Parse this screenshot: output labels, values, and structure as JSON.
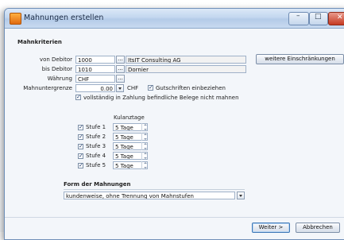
{
  "window": {
    "title": "Mahnungen erstellen",
    "minimize_symbol": "–",
    "maximize_symbol": "□",
    "close_symbol": "✕"
  },
  "criteria": {
    "heading": "Mahnkriterien",
    "von_debitor_label": "von Debitor",
    "von_debitor_value": "1000",
    "von_debitor_name": "ItsIT Consulting AG",
    "bis_debitor_label": "bis Debitor",
    "bis_debitor_value": "1010",
    "bis_debitor_name": "Dornier",
    "waehrung_label": "Währung",
    "waehrung_value": "CHF",
    "lookup_label": "...",
    "mahnuntergrenze_label": "Mahnuntergrenze",
    "mahnuntergrenze_value": "0.00",
    "mahnuntergrenze_currency": "CHF",
    "gutschriften_label": "Gutschriften einbeziehen",
    "gutschriften_checked": true,
    "vollstaendig_label": "vollständig in Zahlung befindliche Belege nicht mahnen",
    "vollstaendig_checked": true,
    "weitere_button": "weitere Einschränkungen"
  },
  "kulanz": {
    "heading": "Kulanztage",
    "rows": [
      {
        "label": "Stufe 1",
        "value": "5 Tage",
        "checked": true
      },
      {
        "label": "Stufe 2",
        "value": "5 Tage",
        "checked": true
      },
      {
        "label": "Stufe 3",
        "value": "5 Tage",
        "checked": true
      },
      {
        "label": "Stufe 4",
        "value": "5 Tage",
        "checked": true
      },
      {
        "label": "Stufe 5",
        "value": "5 Tage",
        "checked": true
      }
    ]
  },
  "form": {
    "heading": "Form der Mahnungen",
    "selected": "kundenweise, ohne Trennung von Mahnstufen"
  },
  "footer": {
    "weiter": "Weiter >",
    "abbrechen": "Abbrechen"
  },
  "check_mark": "✓"
}
